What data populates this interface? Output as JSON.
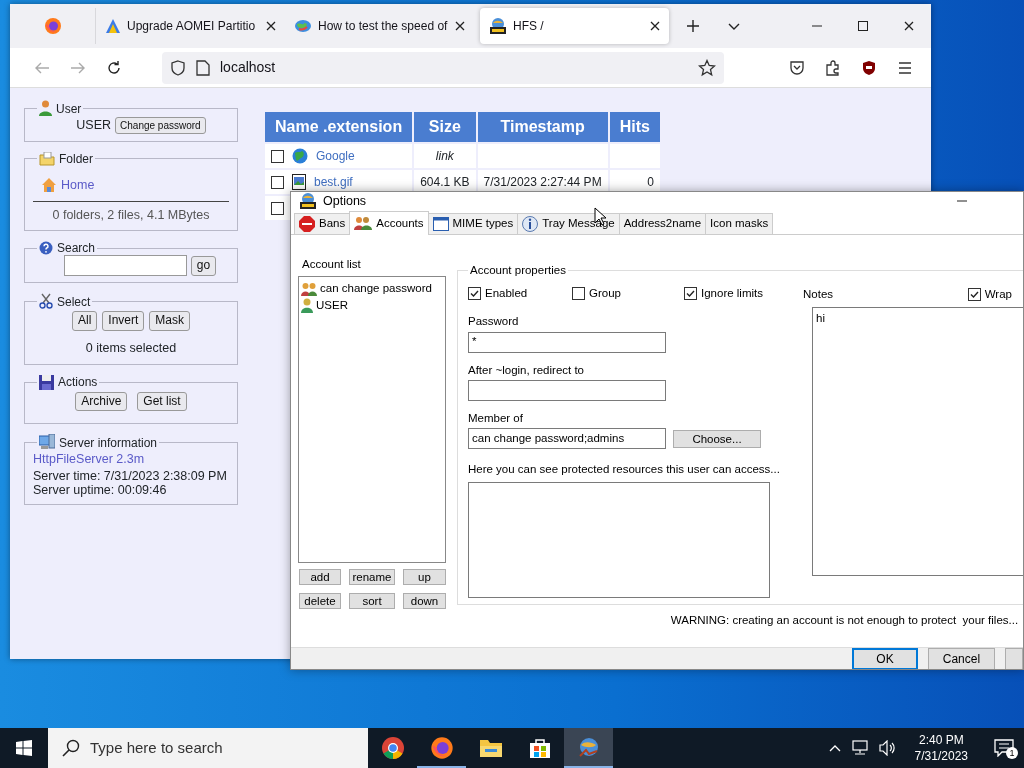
{
  "browser": {
    "tabs": [
      {
        "kind": "pinned",
        "selected": false
      },
      {
        "kind": "page",
        "label": "Upgrade AOMEI Partitio",
        "selected": false
      },
      {
        "kind": "page",
        "label": "How to test the speed of",
        "selected": false
      },
      {
        "kind": "page",
        "label": "HFS /",
        "selected": true
      }
    ],
    "address": "localhost"
  },
  "page": {
    "sidebar": [
      {
        "kind": "user",
        "title": "User",
        "text": "USER",
        "buttons": [
          "Change password"
        ]
      },
      {
        "kind": "folder",
        "title": "Folder",
        "link": "Home",
        "summary": "0 folders, 2 files, 4.1 MBytes"
      },
      {
        "kind": "search",
        "title": "Search",
        "buttons": [
          "go"
        ]
      },
      {
        "kind": "select",
        "title": "Select",
        "buttons": [
          "All",
          "Invert",
          "Mask"
        ],
        "summary": "0 items selected"
      },
      {
        "kind": "actions",
        "title": "Actions",
        "buttons": [
          "Archive",
          "Get list"
        ]
      },
      {
        "kind": "server",
        "title": "Server information",
        "link": "HttpFileServer 2.3m",
        "lines": [
          "Server time: 7/31/2023 2:38:09 PM",
          "Server uptime: 00:09:46"
        ]
      }
    ],
    "file_table": {
      "columns": [
        "Name .extension",
        "Size",
        "Timestamp",
        "Hits"
      ],
      "rows": [
        {
          "kind": "link",
          "checked": false,
          "name": "Google",
          "size": "link"
        },
        {
          "kind": "file",
          "checked": false,
          "name": "best.gif",
          "size": "604.1 KB",
          "timestamp": "7/31/2023 2:27:44 PM",
          "hits": "0"
        },
        {
          "checked": false
        }
      ]
    }
  },
  "options_dialog": {
    "title": "Options",
    "tabs": [
      {
        "label": "Bans",
        "selected": false
      },
      {
        "label": "Accounts",
        "selected": true
      },
      {
        "label": "MIME types",
        "selected": false
      },
      {
        "label": "Tray Message",
        "selected": false
      },
      {
        "label": "Address2name",
        "selected": false
      },
      {
        "label": "Icon masks",
        "selected": false
      }
    ],
    "account_list": {
      "label": "Account list",
      "items": [
        {
          "kind": "group",
          "name": "can change password",
          "selected": false
        },
        {
          "kind": "user",
          "name": "USER",
          "selected": false
        }
      ],
      "buttons": [
        "add",
        "rename",
        "up",
        "delete",
        "sort",
        "down"
      ]
    },
    "properties": {
      "title": "Account properties",
      "checks": [
        {
          "label": "Enabled",
          "checked": true
        },
        {
          "label": "Group",
          "checked": false
        },
        {
          "label": "Ignore limits",
          "checked": true
        }
      ],
      "fields": [
        {
          "label": "Password",
          "value": "*"
        },
        {
          "label": "After ~login, redirect to"
        },
        {
          "label": "Member of",
          "value": "can change password;admins",
          "button": "Choose..."
        }
      ],
      "resources_label": "Here you can see protected resources this user can access...",
      "notes": {
        "label": "Notes",
        "wrap": {
          "label": "Wrap",
          "checked": true
        },
        "value": "hi"
      }
    },
    "warning": "WARNING: creating an account is not enough to protect  your files...",
    "buttons": [
      "OK",
      "Cancel"
    ]
  },
  "taskbar": {
    "search_placeholder": "Type here to search",
    "apps": [
      {
        "running": false,
        "selected": false
      },
      {
        "running": true,
        "selected": false
      },
      {
        "running": false,
        "selected": false
      },
      {
        "running": false,
        "selected": false
      },
      {
        "running": true,
        "selected": true
      }
    ],
    "time": "2:40 PM",
    "date": "7/31/2023",
    "notifications": "1"
  }
}
